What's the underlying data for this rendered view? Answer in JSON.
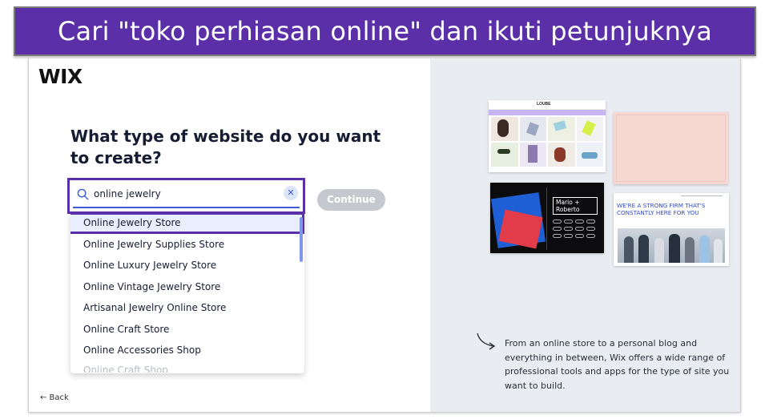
{
  "banner": {
    "text": "Cari \"toko perhiasan online\" dan ikuti petunjuknya"
  },
  "app": {
    "logo": "WIX"
  },
  "question": {
    "text": "What type of website do you want to create?"
  },
  "search": {
    "value": "online jewelry",
    "clear_icon": "close-icon",
    "search_icon": "search-icon"
  },
  "continue_label": "Continue",
  "suggestions": [
    {
      "label": "Online Jewelry Store"
    },
    {
      "label": "Online Jewelry Supplies Store"
    },
    {
      "label": "Online Luxury Jewelry Store"
    },
    {
      "label": "Online Vintage Jewelry Store"
    },
    {
      "label": "Artisanal Jewelry Online Store"
    },
    {
      "label": "Online Craft Store"
    },
    {
      "label": "Online Accessories Shop"
    },
    {
      "label": "Online Craft Shop"
    }
  ],
  "back_label": "← Back",
  "thumbnails": {
    "store_brand": "LOUBE",
    "portfolio_name": "Mario + Roberto",
    "firm_headline": "WE'RE A STRONG FIRM THAT'S CONSTANTLY HERE FOR YOU"
  },
  "info": {
    "text": "From an online store to a personal blog and everything in between, Wix offers a wide range of professional tools and apps for the type of site you want to build."
  },
  "colors": {
    "banner": "#5a2fa8",
    "highlight": "#5a2fa8",
    "accent": "#3b5bd6",
    "continue_disabled": "#c5c8ce",
    "right_pane": "#e9ecf0"
  }
}
